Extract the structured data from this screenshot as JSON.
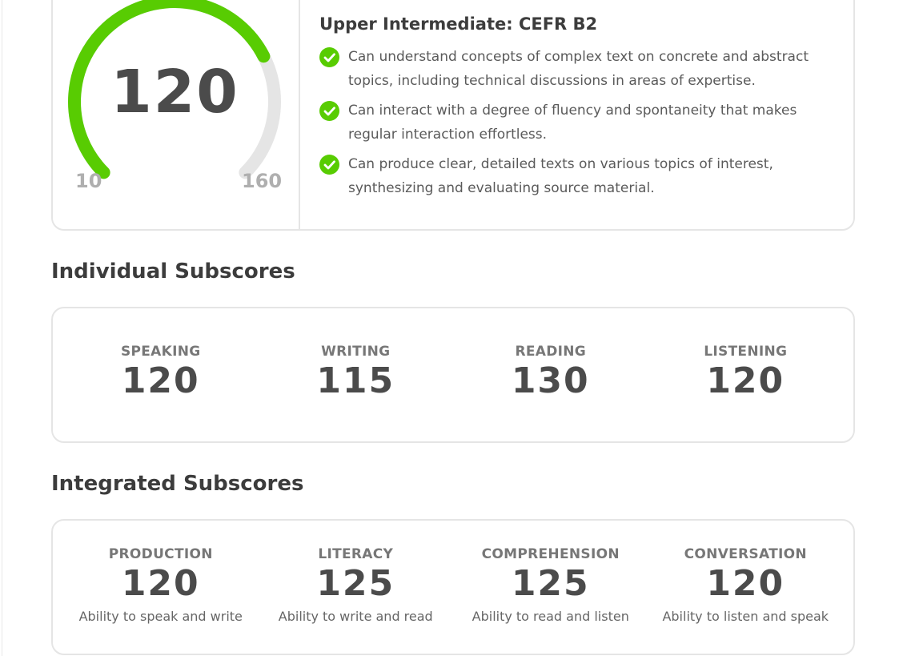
{
  "overall": {
    "score": "120",
    "min": "10",
    "max": "160",
    "score_value": 120,
    "range": [
      10,
      160
    ],
    "fill_color": "#58cc02",
    "track_color": "#e5e5e5",
    "level_title": "Upper Intermediate: CEFR B2",
    "can_do": [
      "Can understand concepts of complex text on concrete and abstract topics, including technical discussions in areas of expertise.",
      "Can interact with a degree of fluency and spontaneity that makes regular interaction effortless.",
      "Can produce clear, detailed texts on various topics of interest, synthesizing and evaluating source material."
    ],
    "check_icon": "check-circle-icon"
  },
  "individual": {
    "title": "Individual Subscores",
    "items": [
      {
        "label": "SPEAKING",
        "value": "120"
      },
      {
        "label": "WRITING",
        "value": "115"
      },
      {
        "label": "READING",
        "value": "130"
      },
      {
        "label": "LISTENING",
        "value": "120"
      }
    ]
  },
  "integrated": {
    "title": "Integrated Subscores",
    "items": [
      {
        "label": "PRODUCTION",
        "value": "120",
        "desc": "Ability to speak and write"
      },
      {
        "label": "LITERACY",
        "value": "125",
        "desc": "Ability to write and read"
      },
      {
        "label": "COMPREHENSION",
        "value": "125",
        "desc": "Ability to read and listen"
      },
      {
        "label": "CONVERSATION",
        "value": "120",
        "desc": "Ability to listen and speak"
      }
    ]
  }
}
